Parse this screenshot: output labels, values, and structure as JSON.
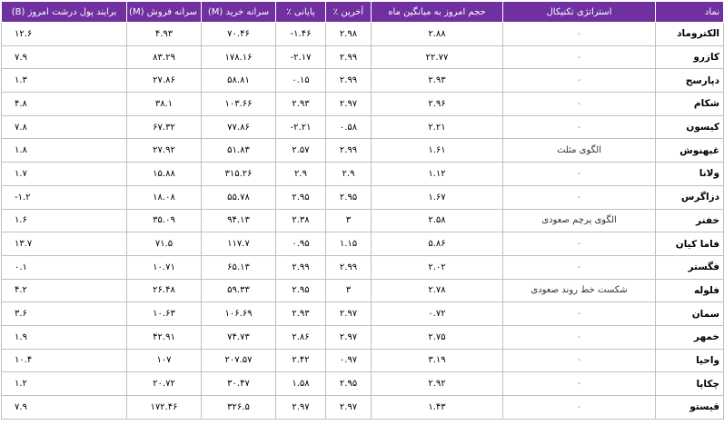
{
  "table": {
    "headers": {
      "symbol": "نماد",
      "strategy": "استراتژی تکنیکال",
      "volume_ratio": "حجم امروز به میانگین ماه",
      "last_pct": "آخرین ٪",
      "close_pct": "پایانی ٪",
      "buy_per_capita": "سرانه خرید (M)",
      "sell_per_capita": "سرانه فروش (M)",
      "net_money_flow": "برایند پول درشت امروز (B)"
    },
    "rows": [
      {
        "symbol": "الکتروماد",
        "strategy": "-",
        "volume_ratio": "۲.۸۸",
        "last_pct": "۲.۹۸",
        "close_pct": "-۱.۴۶",
        "buy_per_capita": "۷۰.۴۶",
        "sell_per_capita": "۴.۹۳",
        "net_money_flow": "۱۲.۶"
      },
      {
        "symbol": "کازرو",
        "strategy": "-",
        "volume_ratio": "۲۲.۷۷",
        "last_pct": "۲.۹۹",
        "close_pct": "-۲.۱۷",
        "buy_per_capita": "۱۷۸.۱۶",
        "sell_per_capita": "۸۳.۲۹",
        "net_money_flow": "۷.۹"
      },
      {
        "symbol": "دپارسح",
        "strategy": "-",
        "volume_ratio": "۲.۹۳",
        "last_pct": "۲.۹۹",
        "close_pct": "۰.۱۵",
        "buy_per_capita": "۵۸.۸۱",
        "sell_per_capita": "۲۷.۸۶",
        "net_money_flow": "۱.۳"
      },
      {
        "symbol": "شکام",
        "strategy": "-",
        "volume_ratio": "۲.۹۶",
        "last_pct": "۲.۹۷",
        "close_pct": "۲.۹۳",
        "buy_per_capita": "۱۰۳.۶۶",
        "sell_per_capita": "۳۸.۱",
        "net_money_flow": "۴.۸"
      },
      {
        "symbol": "کیسون",
        "strategy": "-",
        "volume_ratio": "۲.۲۱",
        "last_pct": "۰.۵۸",
        "close_pct": "-۲.۲۱",
        "buy_per_capita": "۷۷.۸۶",
        "sell_per_capita": "۶۷.۳۲",
        "net_money_flow": "۷.۸"
      },
      {
        "symbol": "غبهنوش",
        "strategy": "الگوی مثلث",
        "volume_ratio": "۱.۶۱",
        "last_pct": "۲.۹۹",
        "close_pct": "۲.۵۷",
        "buy_per_capita": "۵۱.۸۳",
        "sell_per_capita": "۲۷.۹۲",
        "net_money_flow": "۱.۸"
      },
      {
        "symbol": "ولانا",
        "strategy": "-",
        "volume_ratio": "۱.۱۲",
        "last_pct": "۲.۹",
        "close_pct": "۲.۹",
        "buy_per_capita": "۳۱۵.۲۶",
        "sell_per_capita": "۱۵.۸۸",
        "net_money_flow": "۱.۷"
      },
      {
        "symbol": "دزاگرس",
        "strategy": "-",
        "volume_ratio": "۱.۶۷",
        "last_pct": "۲.۹۵",
        "close_pct": "۲.۹۵",
        "buy_per_capita": "۵۵.۷۸",
        "sell_per_capita": "۱۸.۰۸",
        "net_money_flow": "-۱.۲"
      },
      {
        "symbol": "خفنر",
        "strategy": "الگوی پرچم صعودی",
        "volume_ratio": "۲.۵۸",
        "last_pct": "۳",
        "close_pct": "۲.۳۸",
        "buy_per_capita": "۹۴.۱۳",
        "sell_per_capita": "۳۵.۰۹",
        "net_money_flow": "۱.۶"
      },
      {
        "symbol": "فاما کیان",
        "strategy": "-",
        "volume_ratio": "۵.۸۶",
        "last_pct": "۱.۱۵",
        "close_pct": "۰.۹۵",
        "buy_per_capita": "۱۱۷.۷",
        "sell_per_capita": "۷۱.۵",
        "net_money_flow": "۱۳.۷"
      },
      {
        "symbol": "فگستر",
        "strategy": "-",
        "volume_ratio": "۲.۰۲",
        "last_pct": "۲.۹۹",
        "close_pct": "۲.۹۹",
        "buy_per_capita": "۶۵.۱۳",
        "sell_per_capita": "۱۰.۷۱",
        "net_money_flow": "۰.۱"
      },
      {
        "symbol": "فلوله",
        "strategy": "شکست خط روند صعودی",
        "volume_ratio": "۲.۷۸",
        "last_pct": "۳",
        "close_pct": "۲.۹۵",
        "buy_per_capita": "۵۹.۳۳",
        "sell_per_capita": "۲۶.۴۸",
        "net_money_flow": "۴.۲"
      },
      {
        "symbol": "سمان",
        "strategy": "-",
        "volume_ratio": "۰.۷۲",
        "last_pct": "۲.۹۷",
        "close_pct": "۲.۹۳",
        "buy_per_capita": "۱۰۶.۶۹",
        "sell_per_capita": "۱۰.۶۳",
        "net_money_flow": "۳.۶"
      },
      {
        "symbol": "خمهر",
        "strategy": "-",
        "volume_ratio": "۲.۷۵",
        "last_pct": "۲.۹۷",
        "close_pct": "۲.۸۶",
        "buy_per_capita": "۷۴.۷۳",
        "sell_per_capita": "۴۲.۹۱",
        "net_money_flow": "۱.۹"
      },
      {
        "symbol": "واحیا",
        "strategy": "-",
        "volume_ratio": "۳.۱۹",
        "last_pct": "۰.۹۷",
        "close_pct": "۲.۴۲",
        "buy_per_capita": "۲۰۷.۵۷",
        "sell_per_capita": "۱۰۷",
        "net_money_flow": "۱۰.۴"
      },
      {
        "symbol": "چکاپا",
        "strategy": "-",
        "volume_ratio": "۲.۹۲",
        "last_pct": "۲.۹۵",
        "close_pct": "۱.۵۸",
        "buy_per_capita": "۳۰.۴۷",
        "sell_per_capita": "۲۰.۷۲",
        "net_money_flow": "۱.۲"
      },
      {
        "symbol": "قیستو",
        "strategy": "-",
        "volume_ratio": "۱.۴۳",
        "last_pct": "۲.۹۷",
        "close_pct": "۲.۹۷",
        "buy_per_capita": "۳۲۶.۵",
        "sell_per_capita": "۱۷۲.۴۶",
        "net_money_flow": "۷.۹"
      }
    ]
  },
  "colors": {
    "header_background": "#7030a0",
    "header_text": "#ffffff",
    "grid": "#bfbfbf"
  }
}
